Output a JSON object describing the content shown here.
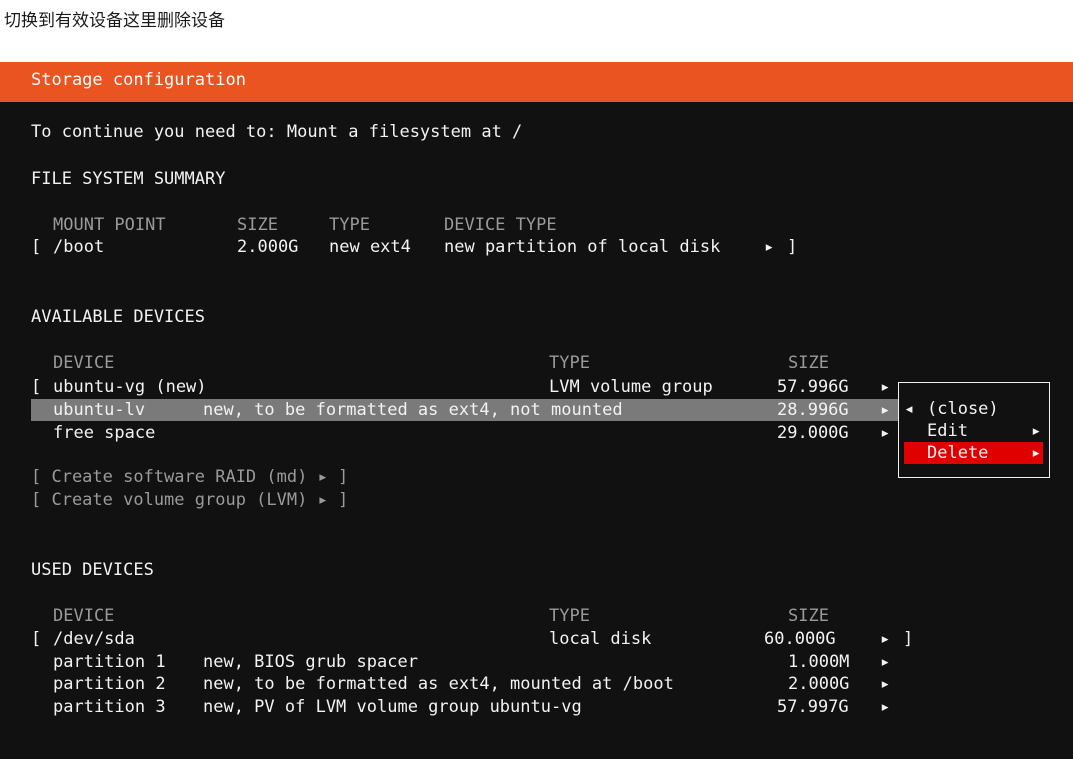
{
  "caption": "切换到有效设备这里删除设备",
  "window": {
    "title": "Storage configuration"
  },
  "notice": "To continue you need to: Mount a filesystem at /",
  "fs_summary": {
    "heading": "FILE SYSTEM SUMMARY",
    "headers": [
      "MOUNT POINT",
      "SIZE",
      "TYPE",
      "DEVICE TYPE"
    ],
    "rows": [
      {
        "bracket_open": "[",
        "mount": "/boot",
        "size": "2.000G",
        "type": "new ext4",
        "device_type": "new partition of local disk",
        "arrow": "▸",
        "bracket_close": "]"
      }
    ]
  },
  "available": {
    "heading": "AVAILABLE DEVICES",
    "headers": [
      "DEVICE",
      "TYPE",
      "SIZE"
    ],
    "rows": [
      {
        "bracket": "[",
        "device": "ubuntu-vg (new)",
        "type": "LVM volume group",
        "size": "57.996G",
        "arrow": "▸"
      },
      {
        "device": "ubuntu-lv",
        "desc": "new, to be formatted as ext4, not mounted",
        "size": "28.996G",
        "arrow": "▸"
      },
      {
        "device": "free space",
        "size": "29.000G",
        "arrow": "▸"
      }
    ],
    "actions": [
      "[ Create software RAID (md) ▸ ]",
      "[ Create volume group (LVM) ▸ ]"
    ]
  },
  "menu": {
    "items": [
      {
        "prefix": "◂",
        "label": "(close)"
      },
      {
        "label": "Edit",
        "arrow": "▸"
      },
      {
        "label": "Delete",
        "arrow": "▸"
      }
    ]
  },
  "used": {
    "heading": "USED DEVICES",
    "headers": [
      "DEVICE",
      "TYPE",
      "SIZE"
    ],
    "rows": [
      {
        "bracket_open": "[",
        "device": "/dev/sda",
        "type": "local disk",
        "size": "60.000G",
        "arrow": "▸",
        "bracket_close": "]"
      },
      {
        "device": "partition 1",
        "desc": "new, BIOS grub spacer",
        "size": "1.000M",
        "arrow": "▸"
      },
      {
        "device": "partition 2",
        "desc": "new, to be formatted as ext4, mounted at /boot",
        "size": "2.000G",
        "arrow": "▸"
      },
      {
        "device": "partition 3",
        "desc": "new, PV of LVM volume group ubuntu-vg",
        "size": "57.997G",
        "arrow": "▸"
      }
    ]
  },
  "colors": {
    "accent": "#e95420",
    "background": "#111111",
    "selection": "#7a7a7a",
    "danger": "#e00000"
  }
}
